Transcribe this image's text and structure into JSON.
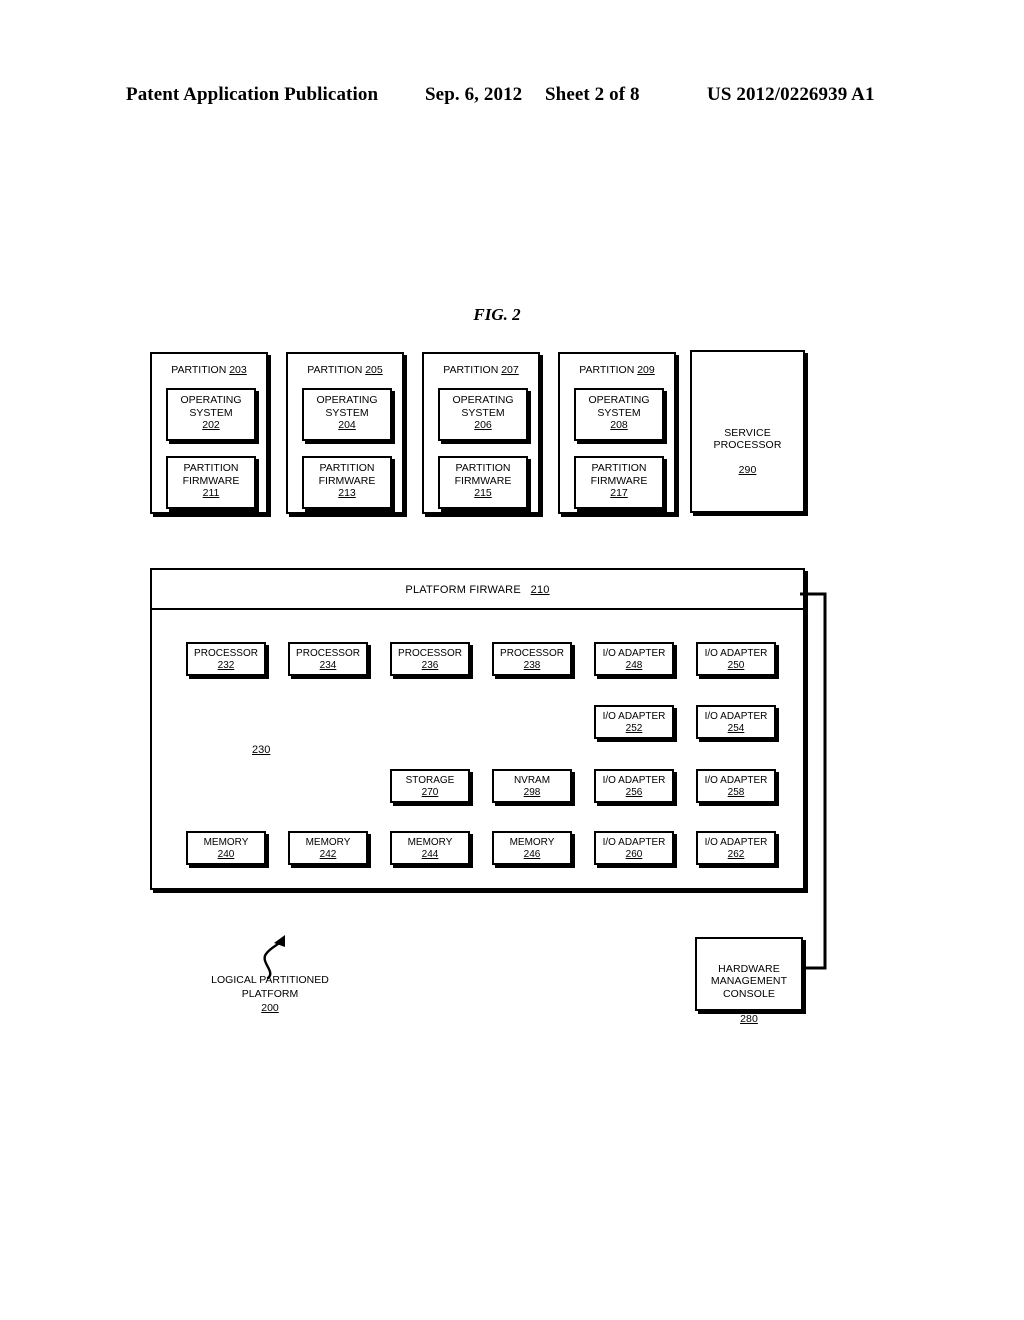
{
  "header": {
    "publication": "Patent Application Publication",
    "date": "Sep. 6, 2012",
    "sheet": "Sheet 2 of 8",
    "patent_number": "US 2012/0226939 A1"
  },
  "figure": {
    "label": "FIG. 2"
  },
  "partitions": [
    {
      "title_text": "PARTITION",
      "title_ref": "203",
      "os_label": "OPERATING\nSYSTEM",
      "os_ref": "202",
      "fw_label": "PARTITION\nFIRMWARE",
      "fw_ref": "211"
    },
    {
      "title_text": "PARTITION",
      "title_ref": "205",
      "os_label": "OPERATING\nSYSTEM",
      "os_ref": "204",
      "fw_label": "PARTITION\nFIRMWARE",
      "fw_ref": "213"
    },
    {
      "title_text": "PARTITION",
      "title_ref": "207",
      "os_label": "OPERATING\nSYSTEM",
      "os_ref": "206",
      "fw_label": "PARTITION\nFIRMWARE",
      "fw_ref": "215"
    },
    {
      "title_text": "PARTITION",
      "title_ref": "209",
      "os_label": "OPERATING\nSYSTEM",
      "os_ref": "208",
      "fw_label": "PARTITION\nFIRMWARE",
      "fw_ref": "217"
    }
  ],
  "service_processor": {
    "label": "SERVICE\nPROCESSOR",
    "ref": "290"
  },
  "platform_firmware": {
    "label": "PLATFORM FIRWARE",
    "ref": "210"
  },
  "hardware_ref": "230",
  "hardware": {
    "row1": [
      {
        "label": "PROCESSOR",
        "ref": "232"
      },
      {
        "label": "PROCESSOR",
        "ref": "234"
      },
      {
        "label": "PROCESSOR",
        "ref": "236"
      },
      {
        "label": "PROCESSOR",
        "ref": "238"
      },
      {
        "label": "I/O ADAPTER",
        "ref": "248"
      },
      {
        "label": "I/O ADAPTER",
        "ref": "250"
      }
    ],
    "row2": [
      {
        "label": "I/O ADAPTER",
        "ref": "252"
      },
      {
        "label": "I/O ADAPTER",
        "ref": "254"
      }
    ],
    "row3": [
      {
        "label": "STORAGE",
        "ref": "270"
      },
      {
        "label": "NVRAM",
        "ref": "298"
      },
      {
        "label": "I/O ADAPTER",
        "ref": "256"
      },
      {
        "label": "I/O ADAPTER",
        "ref": "258"
      }
    ],
    "row4": [
      {
        "label": "MEMORY",
        "ref": "240"
      },
      {
        "label": "MEMORY",
        "ref": "242"
      },
      {
        "label": "MEMORY",
        "ref": "244"
      },
      {
        "label": "MEMORY",
        "ref": "246"
      },
      {
        "label": "I/O ADAPTER",
        "ref": "260"
      },
      {
        "label": "I/O ADAPTER",
        "ref": "262"
      }
    ]
  },
  "hmc": {
    "label": "HARDWARE\nMANAGEMENT\nCONSOLE",
    "ref": "280"
  },
  "caption": {
    "label": "LOGICAL PARTITIONED\nPLATFORM",
    "ref": "200"
  }
}
